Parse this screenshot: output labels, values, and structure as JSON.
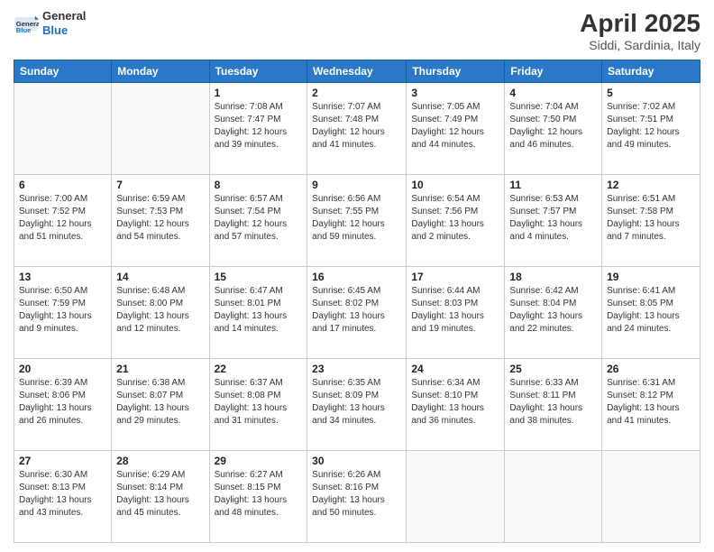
{
  "header": {
    "logo_general": "General",
    "logo_blue": "Blue",
    "title": "April 2025",
    "subtitle": "Siddi, Sardinia, Italy"
  },
  "weekdays": [
    "Sunday",
    "Monday",
    "Tuesday",
    "Wednesday",
    "Thursday",
    "Friday",
    "Saturday"
  ],
  "weeks": [
    [
      {
        "day": "",
        "sunrise": "",
        "sunset": "",
        "daylight": ""
      },
      {
        "day": "",
        "sunrise": "",
        "sunset": "",
        "daylight": ""
      },
      {
        "day": "1",
        "sunrise": "Sunrise: 7:08 AM",
        "sunset": "Sunset: 7:47 PM",
        "daylight": "Daylight: 12 hours and 39 minutes."
      },
      {
        "day": "2",
        "sunrise": "Sunrise: 7:07 AM",
        "sunset": "Sunset: 7:48 PM",
        "daylight": "Daylight: 12 hours and 41 minutes."
      },
      {
        "day": "3",
        "sunrise": "Sunrise: 7:05 AM",
        "sunset": "Sunset: 7:49 PM",
        "daylight": "Daylight: 12 hours and 44 minutes."
      },
      {
        "day": "4",
        "sunrise": "Sunrise: 7:04 AM",
        "sunset": "Sunset: 7:50 PM",
        "daylight": "Daylight: 12 hours and 46 minutes."
      },
      {
        "day": "5",
        "sunrise": "Sunrise: 7:02 AM",
        "sunset": "Sunset: 7:51 PM",
        "daylight": "Daylight: 12 hours and 49 minutes."
      }
    ],
    [
      {
        "day": "6",
        "sunrise": "Sunrise: 7:00 AM",
        "sunset": "Sunset: 7:52 PM",
        "daylight": "Daylight: 12 hours and 51 minutes."
      },
      {
        "day": "7",
        "sunrise": "Sunrise: 6:59 AM",
        "sunset": "Sunset: 7:53 PM",
        "daylight": "Daylight: 12 hours and 54 minutes."
      },
      {
        "day": "8",
        "sunrise": "Sunrise: 6:57 AM",
        "sunset": "Sunset: 7:54 PM",
        "daylight": "Daylight: 12 hours and 57 minutes."
      },
      {
        "day": "9",
        "sunrise": "Sunrise: 6:56 AM",
        "sunset": "Sunset: 7:55 PM",
        "daylight": "Daylight: 12 hours and 59 minutes."
      },
      {
        "day": "10",
        "sunrise": "Sunrise: 6:54 AM",
        "sunset": "Sunset: 7:56 PM",
        "daylight": "Daylight: 13 hours and 2 minutes."
      },
      {
        "day": "11",
        "sunrise": "Sunrise: 6:53 AM",
        "sunset": "Sunset: 7:57 PM",
        "daylight": "Daylight: 13 hours and 4 minutes."
      },
      {
        "day": "12",
        "sunrise": "Sunrise: 6:51 AM",
        "sunset": "Sunset: 7:58 PM",
        "daylight": "Daylight: 13 hours and 7 minutes."
      }
    ],
    [
      {
        "day": "13",
        "sunrise": "Sunrise: 6:50 AM",
        "sunset": "Sunset: 7:59 PM",
        "daylight": "Daylight: 13 hours and 9 minutes."
      },
      {
        "day": "14",
        "sunrise": "Sunrise: 6:48 AM",
        "sunset": "Sunset: 8:00 PM",
        "daylight": "Daylight: 13 hours and 12 minutes."
      },
      {
        "day": "15",
        "sunrise": "Sunrise: 6:47 AM",
        "sunset": "Sunset: 8:01 PM",
        "daylight": "Daylight: 13 hours and 14 minutes."
      },
      {
        "day": "16",
        "sunrise": "Sunrise: 6:45 AM",
        "sunset": "Sunset: 8:02 PM",
        "daylight": "Daylight: 13 hours and 17 minutes."
      },
      {
        "day": "17",
        "sunrise": "Sunrise: 6:44 AM",
        "sunset": "Sunset: 8:03 PM",
        "daylight": "Daylight: 13 hours and 19 minutes."
      },
      {
        "day": "18",
        "sunrise": "Sunrise: 6:42 AM",
        "sunset": "Sunset: 8:04 PM",
        "daylight": "Daylight: 13 hours and 22 minutes."
      },
      {
        "day": "19",
        "sunrise": "Sunrise: 6:41 AM",
        "sunset": "Sunset: 8:05 PM",
        "daylight": "Daylight: 13 hours and 24 minutes."
      }
    ],
    [
      {
        "day": "20",
        "sunrise": "Sunrise: 6:39 AM",
        "sunset": "Sunset: 8:06 PM",
        "daylight": "Daylight: 13 hours and 26 minutes."
      },
      {
        "day": "21",
        "sunrise": "Sunrise: 6:38 AM",
        "sunset": "Sunset: 8:07 PM",
        "daylight": "Daylight: 13 hours and 29 minutes."
      },
      {
        "day": "22",
        "sunrise": "Sunrise: 6:37 AM",
        "sunset": "Sunset: 8:08 PM",
        "daylight": "Daylight: 13 hours and 31 minutes."
      },
      {
        "day": "23",
        "sunrise": "Sunrise: 6:35 AM",
        "sunset": "Sunset: 8:09 PM",
        "daylight": "Daylight: 13 hours and 34 minutes."
      },
      {
        "day": "24",
        "sunrise": "Sunrise: 6:34 AM",
        "sunset": "Sunset: 8:10 PM",
        "daylight": "Daylight: 13 hours and 36 minutes."
      },
      {
        "day": "25",
        "sunrise": "Sunrise: 6:33 AM",
        "sunset": "Sunset: 8:11 PM",
        "daylight": "Daylight: 13 hours and 38 minutes."
      },
      {
        "day": "26",
        "sunrise": "Sunrise: 6:31 AM",
        "sunset": "Sunset: 8:12 PM",
        "daylight": "Daylight: 13 hours and 41 minutes."
      }
    ],
    [
      {
        "day": "27",
        "sunrise": "Sunrise: 6:30 AM",
        "sunset": "Sunset: 8:13 PM",
        "daylight": "Daylight: 13 hours and 43 minutes."
      },
      {
        "day": "28",
        "sunrise": "Sunrise: 6:29 AM",
        "sunset": "Sunset: 8:14 PM",
        "daylight": "Daylight: 13 hours and 45 minutes."
      },
      {
        "day": "29",
        "sunrise": "Sunrise: 6:27 AM",
        "sunset": "Sunset: 8:15 PM",
        "daylight": "Daylight: 13 hours and 48 minutes."
      },
      {
        "day": "30",
        "sunrise": "Sunrise: 6:26 AM",
        "sunset": "Sunset: 8:16 PM",
        "daylight": "Daylight: 13 hours and 50 minutes."
      },
      {
        "day": "",
        "sunrise": "",
        "sunset": "",
        "daylight": ""
      },
      {
        "day": "",
        "sunrise": "",
        "sunset": "",
        "daylight": ""
      },
      {
        "day": "",
        "sunrise": "",
        "sunset": "",
        "daylight": ""
      }
    ]
  ]
}
